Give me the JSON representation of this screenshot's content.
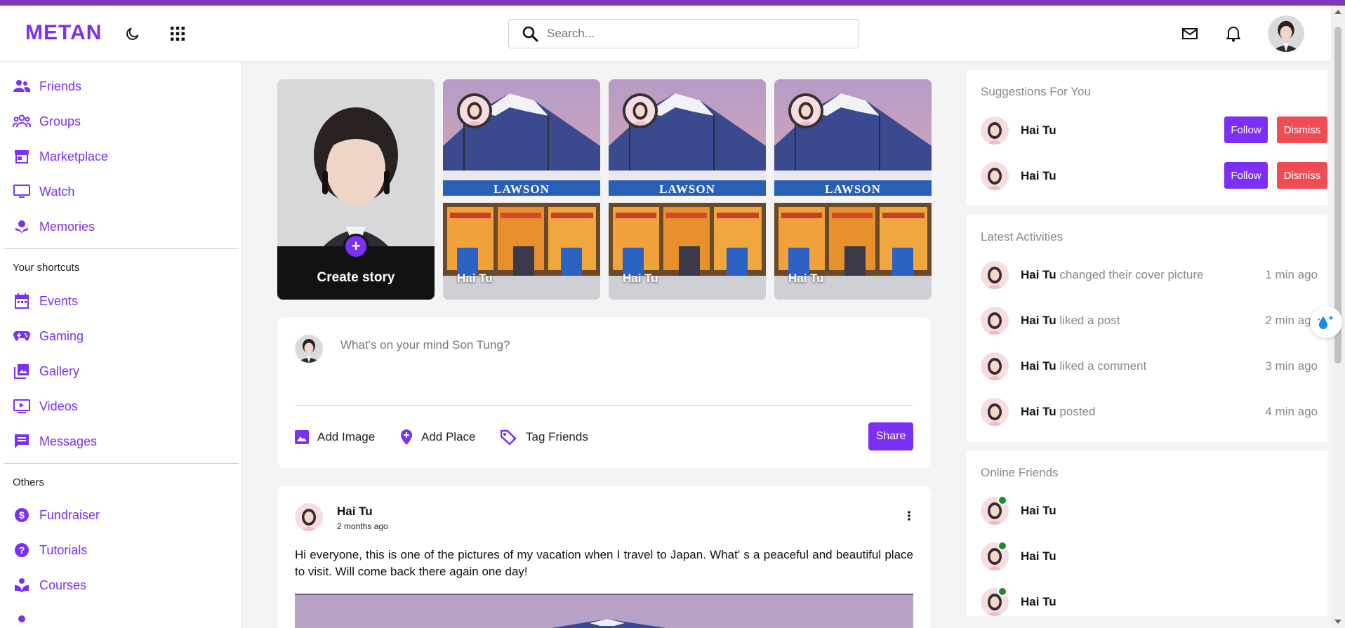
{
  "app": {
    "logo": "METAN",
    "accent": "#7b2ff7"
  },
  "header": {
    "search_placeholder": "Search...",
    "icons": [
      "moon-icon",
      "apps-grid-icon",
      "mail-icon",
      "bell-icon"
    ]
  },
  "sidebar": {
    "main_items": [
      {
        "label": "Friends",
        "icon": "friends-icon"
      },
      {
        "label": "Groups",
        "icon": "groups-icon"
      },
      {
        "label": "Marketplace",
        "icon": "store-icon"
      },
      {
        "label": "Watch",
        "icon": "monitor-icon"
      },
      {
        "label": "Memories",
        "icon": "memories-icon"
      }
    ],
    "shortcuts_title": "Your shortcuts",
    "shortcuts": [
      {
        "label": "Events",
        "icon": "calendar-icon"
      },
      {
        "label": "Gaming",
        "icon": "gamepad-icon"
      },
      {
        "label": "Gallery",
        "icon": "gallery-icon"
      },
      {
        "label": "Videos",
        "icon": "video-icon"
      },
      {
        "label": "Messages",
        "icon": "message-icon"
      }
    ],
    "others_title": "Others",
    "others": [
      {
        "label": "Fundraiser",
        "icon": "dollar-icon"
      },
      {
        "label": "Tutorials",
        "icon": "help-icon"
      },
      {
        "label": "Courses",
        "icon": "courses-icon"
      }
    ]
  },
  "stories": {
    "create_label": "Create story",
    "items": [
      {
        "name": "Hai Tu"
      },
      {
        "name": "Hai Tu"
      },
      {
        "name": "Hai Tu"
      }
    ]
  },
  "composer": {
    "placeholder": "What's on your mind Son Tung?",
    "add_image": "Add Image",
    "add_place": "Add Place",
    "tag_friends": "Tag Friends",
    "share": "Share"
  },
  "post": {
    "author": "Hai Tu",
    "time": "2 months ago",
    "text": "Hi everyone, this is one of the pictures of my vacation when I travel to Japan. What' s a peaceful and beautiful place to visit. Will come back there again one day!"
  },
  "suggestions": {
    "title": "Suggestions For You",
    "follow": "Follow",
    "dismiss": "Dismiss",
    "items": [
      {
        "name": "Hai Tu"
      },
      {
        "name": "Hai Tu"
      }
    ]
  },
  "activities": {
    "title": "Latest Activities",
    "items": [
      {
        "name": "Hai Tu",
        "action": "changed their cover picture",
        "time": "1 min ago"
      },
      {
        "name": "Hai Tu",
        "action": "liked a post",
        "time": "2 min ago"
      },
      {
        "name": "Hai Tu",
        "action": "liked a comment",
        "time": "3 min ago"
      },
      {
        "name": "Hai Tu",
        "action": "posted",
        "time": "4 min ago"
      }
    ]
  },
  "online": {
    "title": "Online Friends",
    "status_color": "#1f8a23",
    "items": [
      {
        "name": "Hai Tu"
      },
      {
        "name": "Hai Tu"
      },
      {
        "name": "Hai Tu"
      }
    ]
  }
}
